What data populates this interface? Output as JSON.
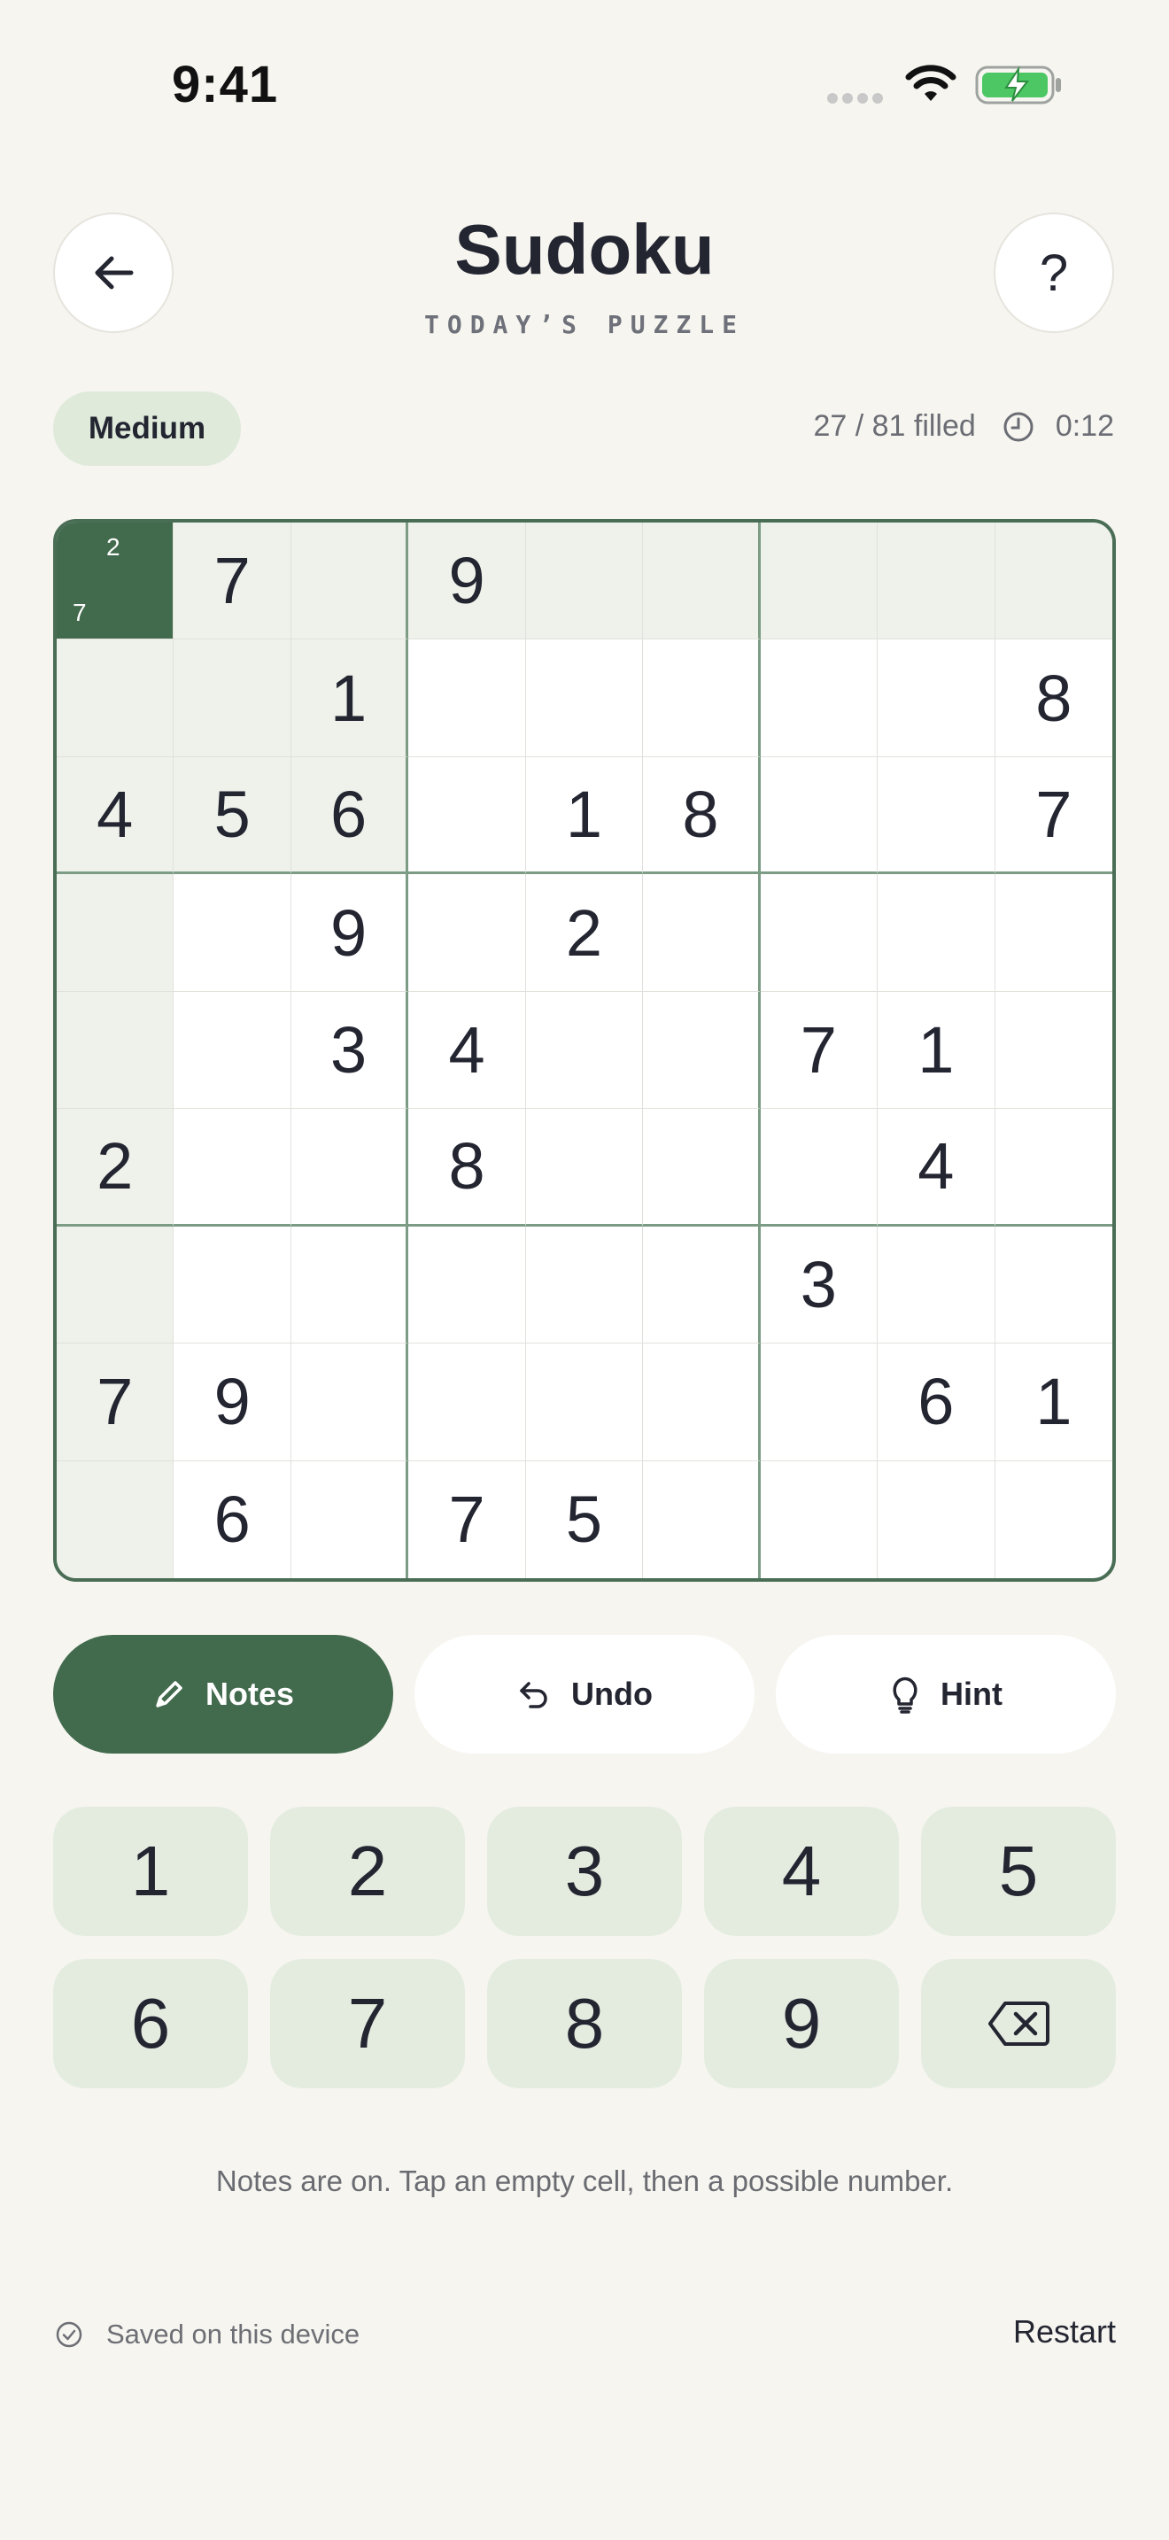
{
  "status_bar": {
    "time": "9:41"
  },
  "header": {
    "title": "Sudoku",
    "subtitle": "TODAY’S PUZZLE",
    "help_label": "?"
  },
  "info": {
    "difficulty": "Medium",
    "progress": "27 / 81 filled",
    "timer": "0:12"
  },
  "grid": {
    "rows": [
      [
        "",
        "7",
        "",
        "9",
        "",
        "",
        "",
        "",
        ""
      ],
      [
        "",
        "",
        "1",
        "",
        "",
        "",
        "",
        "",
        "8"
      ],
      [
        "4",
        "5",
        "6",
        "",
        "1",
        "8",
        "",
        "",
        "7"
      ],
      [
        "",
        "",
        "9",
        "",
        "2",
        "",
        "",
        "",
        ""
      ],
      [
        "",
        "",
        "3",
        "4",
        "",
        "",
        "7",
        "1",
        ""
      ],
      [
        "2",
        "",
        "",
        "8",
        "",
        "",
        "",
        "4",
        ""
      ],
      [
        "",
        "",
        "",
        "",
        "",
        "",
        "3",
        "",
        ""
      ],
      [
        "7",
        "9",
        "",
        "",
        "",
        "",
        "",
        "6",
        "1"
      ],
      [
        "",
        "6",
        "",
        "7",
        "5",
        "",
        "",
        "",
        ""
      ]
    ],
    "selected_cell_notes": [
      "2",
      "7"
    ]
  },
  "actions": {
    "notes_label": "Notes",
    "undo_label": "Undo",
    "hint_label": "Hint"
  },
  "keypad": {
    "keys": [
      "1",
      "2",
      "3",
      "4",
      "5",
      "6",
      "7",
      "8",
      "9"
    ],
    "delete_icon": "backspace-icon"
  },
  "footer": {
    "hint_text": "Notes are on. Tap an empty cell, then a possible number.",
    "saved_text": "Saved on this device",
    "restart_label": "Restart"
  },
  "colors": {
    "accent": "#426a4d",
    "highlight": "#eef2ea",
    "key_bg": "#e4ece0",
    "badge_bg": "#dfeadb",
    "background": "#f6f5f0"
  }
}
